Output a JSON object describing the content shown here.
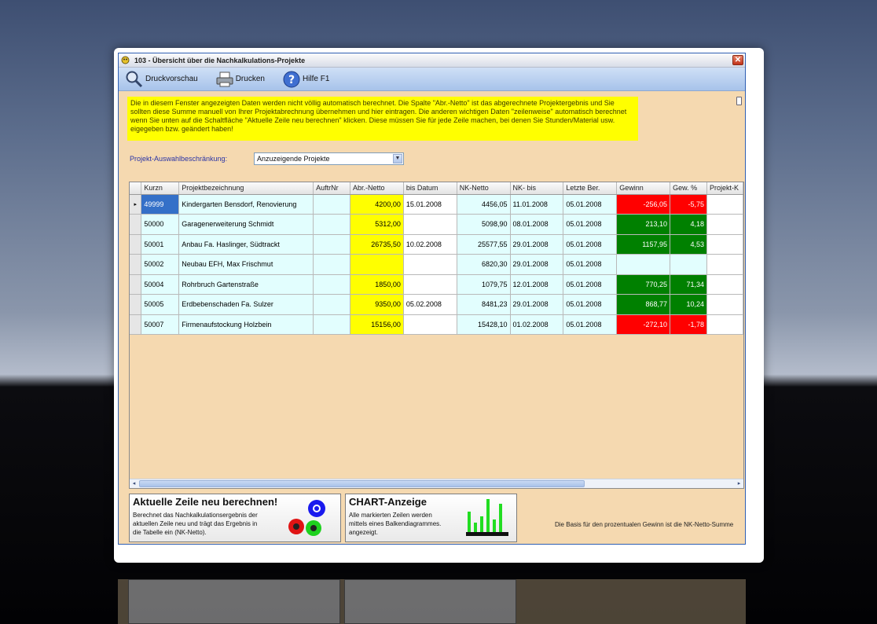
{
  "window": {
    "title": "103  - Übersicht über die Nachkalkulations-Projekte",
    "close_glyph": "✕"
  },
  "toolbar": {
    "preview_label": "Druckvorschau",
    "print_label": "Drucken",
    "help_label": "Hilfe F1"
  },
  "info_text": "Die in diesem Fenster angezeigten Daten werden nicht völlig automatisch berechnet. Die Spalte \"Abr.-Netto\" ist das abgerechnete Projektergebnis und Sie sollten diese Summe manuell von Ihrer Projektabrechnung übernehmen und hier eintragen. Die anderen wichtigen Daten \"zeilenweise\" automatisch berechnet wenn Sie unten auf die Schaltfläche \"Aktuelle Zeile neu berechnen\" klicken. Diese müssen Sie für jede Zeile machen, bei denen Sie Stunden/Material usw. eigegeben bzw. geändert haben!",
  "filter": {
    "label": "Projekt-Auswahlbeschränkung:",
    "selected": "Anzuzeigende Projekte"
  },
  "table": {
    "columns": [
      "Kurzn",
      "Projektbezeichnung",
      "AuftrNr",
      "Abr.-Netto",
      "bis Datum",
      "NK-Netto",
      "NK- bis",
      "Letzte Ber.",
      "Gewinn",
      "Gew. %",
      "Projekt-K"
    ],
    "current_row_marker": "▸",
    "rows": [
      {
        "kurzn": "49999",
        "bez": "Kindergarten Bensdorf, Renovierung",
        "auftr": "",
        "abr": "4200,00",
        "bis": "15.01.2008",
        "nk": "4456,05",
        "nkbis": "11.01.2008",
        "letzte": "05.01.2008",
        "gewinn": "-256,05",
        "gewp": "-5,75",
        "sign": "neg"
      },
      {
        "kurzn": "50000",
        "bez": "Garagenerweiterung Schmidt",
        "auftr": "",
        "abr": "5312,00",
        "bis": "",
        "nk": "5098,90",
        "nkbis": "08.01.2008",
        "letzte": "05.01.2008",
        "gewinn": "213,10",
        "gewp": "4,18",
        "sign": "pos"
      },
      {
        "kurzn": "50001",
        "bez": "Anbau Fa. Haslinger, Südtrackt",
        "auftr": "",
        "abr": "26735,50",
        "bis": "10.02.2008",
        "nk": "25577,55",
        "nkbis": "29.01.2008",
        "letzte": "05.01.2008",
        "gewinn": "1157,95",
        "gewp": "4,53",
        "sign": "pos"
      },
      {
        "kurzn": "50002",
        "bez": "Neubau EFH, Max Frischmut",
        "auftr": "",
        "abr": "",
        "bis": "",
        "nk": "6820,30",
        "nkbis": "29.01.2008",
        "letzte": "05.01.2008",
        "gewinn": "",
        "gewp": "",
        "sign": "none"
      },
      {
        "kurzn": "50004",
        "bez": "Rohrbruch Gartenstraße",
        "auftr": "",
        "abr": "1850,00",
        "bis": "",
        "nk": "1079,75",
        "nkbis": "12.01.2008",
        "letzte": "05.01.2008",
        "gewinn": "770,25",
        "gewp": "71,34",
        "sign": "pos"
      },
      {
        "kurzn": "50005",
        "bez": "Erdbebenschaden Fa. Sulzer",
        "auftr": "",
        "abr": "9350,00",
        "bis": "05.02.2008",
        "nk": "8481,23",
        "nkbis": "29.01.2008",
        "letzte": "05.01.2008",
        "gewinn": "868,77",
        "gewp": "10,24",
        "sign": "pos"
      },
      {
        "kurzn": "50007",
        "bez": "Firmenaufstockung Holzbein",
        "auftr": "",
        "abr": "15156,00",
        "bis": "",
        "nk": "15428,10",
        "nkbis": "01.02.2008",
        "letzte": "05.01.2008",
        "gewinn": "-272,10",
        "gewp": "-1,78",
        "sign": "neg"
      }
    ]
  },
  "panel_recalc": {
    "title": "Aktuelle Zeile neu berechnen!",
    "description": "Berechnet das Nachkalkulationsergebnis der aktuellen Zeile neu und trägt das Ergebnis in die Tabelle ein (NK-Netto)."
  },
  "panel_chart": {
    "title": "CHART-Anzeige",
    "description": "Alle markierten Zeilen werden mittels eines Balkendiagrammes. angezeigt."
  },
  "footnote": "Die Basis für den prozentualen Gewinn ist die NK-Netto-Summe",
  "colors": {
    "window_bg": "#f5d9b0",
    "info_bg": "#ffff00",
    "positive": "#008000",
    "negative": "#ff0000",
    "cyan_cell": "#e2fefe"
  }
}
